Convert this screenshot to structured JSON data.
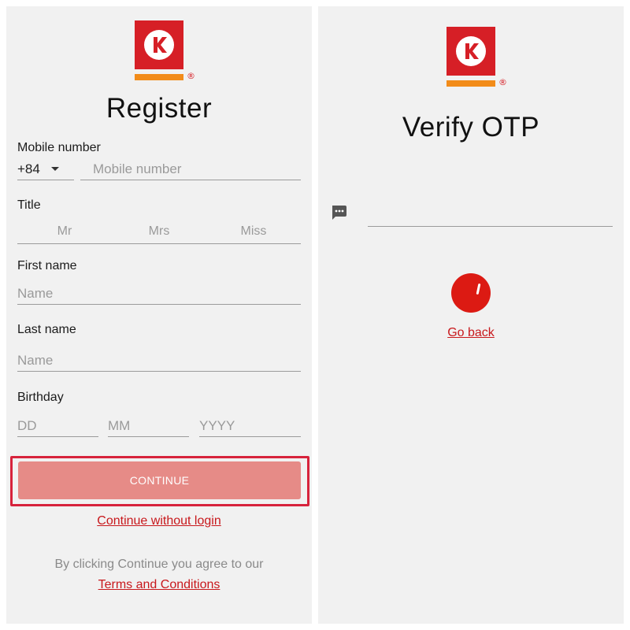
{
  "register": {
    "title": "Register",
    "mobile_label": "Mobile number",
    "country_code": "+84",
    "mobile_placeholder": "Mobile number",
    "title_label": "Title",
    "title_options": [
      "Mr",
      "Mrs",
      "Miss"
    ],
    "first_name_label": "First name",
    "first_name_placeholder": "Name",
    "last_name_label": "Last name",
    "last_name_placeholder": "Name",
    "birthday_label": "Birthday",
    "birthday_dd": "DD",
    "birthday_mm": "MM",
    "birthday_yyyy": "YYYY",
    "continue_label": "CONTINUE",
    "continue_without_login": "Continue without login",
    "terms_note": "By clicking Continue you agree to our",
    "terms_link": "Terms and Conditions"
  },
  "verify": {
    "title": "Verify OTP",
    "go_back": "Go back"
  },
  "logo": {
    "registered_mark": "®",
    "icon": "circle-k-logo"
  },
  "colors": {
    "brand_red": "#d61f26",
    "brand_orange": "#f28c1a",
    "button_disabled": "#e68b87",
    "highlight": "#d7233c",
    "link": "#c8181c"
  },
  "icons": {
    "dropdown": "chevron-down-icon",
    "otp": "sms-message-icon",
    "loading": "loading-spinner"
  }
}
